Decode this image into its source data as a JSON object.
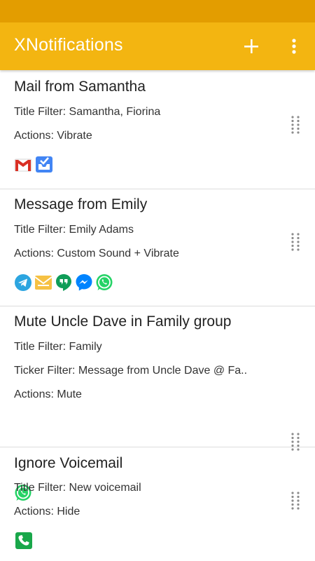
{
  "app": {
    "title": "XNotifications",
    "colors": {
      "status_bar": "#e39d00",
      "app_bar": "#f3b511",
      "text": "#212121",
      "divider": "#dcdcdc"
    },
    "actions": [
      {
        "icon": "add-icon"
      },
      {
        "icon": "more-vert-icon"
      }
    ]
  },
  "rules": [
    {
      "title": "Mail from Samantha",
      "lines": [
        "Title Filter: Samantha,  Fiorina",
        "Actions: Vibrate"
      ],
      "apps": [
        "gmail-icon",
        "inbox-icon"
      ]
    },
    {
      "title": "Message from Emily",
      "lines": [
        "Title Filter: Emily Adams",
        "Actions: Custom Sound + Vibrate"
      ],
      "apps": [
        "telegram-icon",
        "email-icon",
        "hangouts-icon",
        "messenger-icon",
        "whatsapp-icon"
      ]
    },
    {
      "title": "Mute Uncle Dave in Family group",
      "lines": [
        "Title Filter: Family",
        "Ticker Filter: Message from Uncle Dave @ Fa..",
        "Actions: Mute"
      ],
      "apps": [
        "whatsapp-icon"
      ]
    },
    {
      "title": "Ignore Voicemail",
      "lines": [
        "Title Filter: New voicemail",
        "Actions: Hide"
      ],
      "apps": [
        "phone-icon"
      ]
    }
  ]
}
